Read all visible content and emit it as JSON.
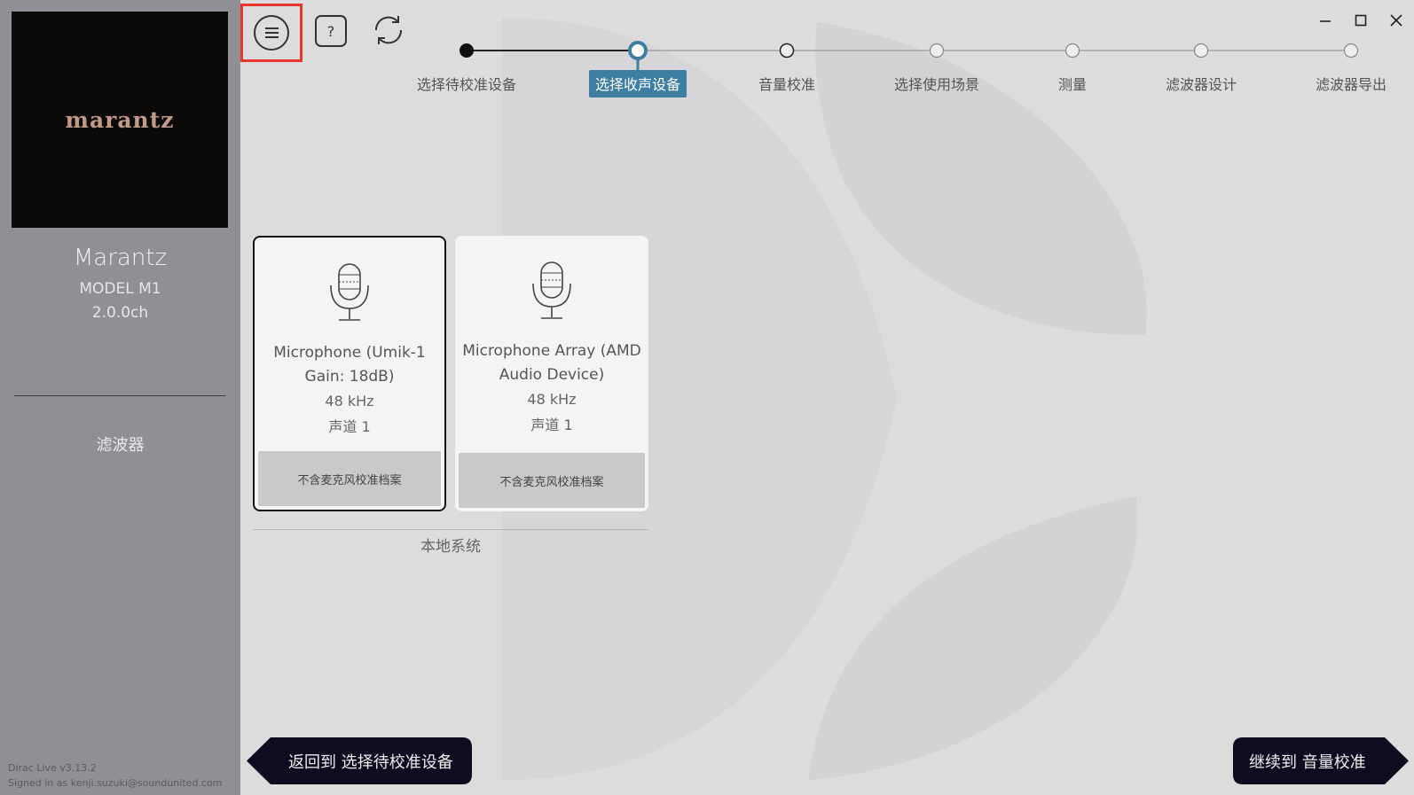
{
  "sidebar": {
    "logo": "marantz",
    "device_name": "Marantz",
    "device_model": "MODEL M1",
    "channels": "2.0.0ch",
    "nav_filter": "滤波器",
    "version": "Dirac Live v3.13.2",
    "signed_in": "Signed in as kenji.suzuki@soundunited.com"
  },
  "toolbar": {
    "menu_icon": "hamburger-icon",
    "help_label": "?",
    "refresh_icon": "refresh-icon"
  },
  "window": {
    "minimize": "—",
    "maximize": "☐",
    "close": "✕"
  },
  "stepper": {
    "active_index": 1,
    "steps": [
      {
        "label": "选择待校准设备"
      },
      {
        "label": "选择收声设备"
      },
      {
        "label": "音量校准"
      },
      {
        "label": "选择使用场景"
      },
      {
        "label": "测量"
      },
      {
        "label": "滤波器设计"
      },
      {
        "label": "滤波器导出"
      }
    ]
  },
  "devices": {
    "group_label": "本地系统",
    "items": [
      {
        "name": "Microphone (Umik-1 Gain: 18dB)",
        "rate": "48 kHz",
        "channels": "声道 1",
        "profile": "不含麦克风校准档案",
        "selected": true
      },
      {
        "name": "Microphone Array (AMD Audio Device)",
        "rate": "48 kHz",
        "channels": "声道 1",
        "profile": "不含麦克风校准档案",
        "selected": false
      }
    ]
  },
  "nav": {
    "back_label": "返回到 选择待校准设备",
    "next_label": "继续到 音量校准"
  },
  "colors": {
    "sidebar_bg": "#908f95",
    "accent": "#3d7ea1",
    "highlight_box": "#e8352d",
    "nav_button": "#0d0d1f"
  }
}
